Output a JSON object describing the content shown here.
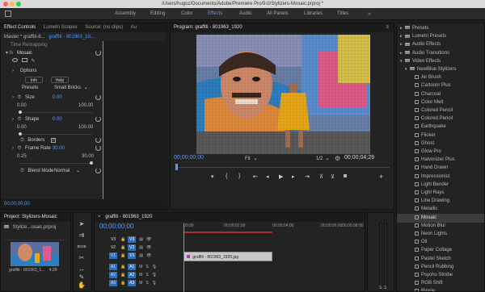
{
  "title_bar": {
    "text": "/Users/hugoz/Documents/Adobe/Premiere Pro/9.0/Stylizers-Mosaic.prproj *"
  },
  "workspaces": [
    "Assembly",
    "Editing",
    "Color",
    "Effects",
    "Audio",
    "All Panels",
    "Libraries",
    "Titles"
  ],
  "active_workspace": "Effects",
  "effect_controls": {
    "tabs": [
      "Effect Controls",
      "Lumetri Scopes",
      "Source: (no clips)",
      "Au"
    ],
    "master": "Master * graffiti-8...",
    "clip": "graffiti - 801963_19...",
    "time_remapping": "Time Remapping",
    "effect_name": "Mosaic",
    "options_label": "Options",
    "preset_buttons": [
      "Info",
      "Help"
    ],
    "presets_label": "Presets",
    "presets_value": "Small Bricks",
    "size": {
      "label": "Size",
      "value": "0.00",
      "min": "0.00",
      "max": "100.00",
      "level": 0.0
    },
    "shape": {
      "label": "Shape",
      "value": "0.00",
      "min": "0.00",
      "max": "100.00",
      "level": 0.0
    },
    "borders": {
      "label": "Borders",
      "checked": true
    },
    "frame_rate": {
      "label": "Frame Rate",
      "value": "30.00",
      "min": "0.25",
      "max": "30.00",
      "level": 1.0
    },
    "blend_mode": {
      "label": "Blend Mode",
      "value": "Normal"
    }
  },
  "program": {
    "tab": "Program: graffiti - 801963_1920",
    "timecode_in": "00;00;00;00",
    "fit": "Fit",
    "ratio": "1/2",
    "timecode_duration": "00;00;04;29"
  },
  "project": {
    "tab": "Project: Stylizers-Mosaic",
    "file": "Stylize...osaic.prproj",
    "clip_name": "graffiti - 801963_1...",
    "clip_duration": "4;29"
  },
  "timeline": {
    "tab": "graffiti - 801963_1920",
    "timecode": "00;00;00;00",
    "ruler": [
      "00;00",
      "00;00;02;00",
      "00;00;04;00",
      "00;00;06;00",
      "00;00;08;00"
    ],
    "video_tracks": [
      "V3",
      "V2",
      "V1"
    ],
    "audio_tracks": [
      "A1",
      "A2",
      "A3"
    ],
    "clip_label": "graffiti - 801963_1920.jpg"
  },
  "effects": {
    "items": [
      {
        "label": "Presets",
        "type": "folder",
        "indent": 0
      },
      {
        "label": "Lumetri Presets",
        "type": "folder",
        "indent": 0
      },
      {
        "label": "Audio Effects",
        "type": "folder",
        "indent": 0
      },
      {
        "label": "Audio Transitions",
        "type": "folder",
        "indent": 0
      },
      {
        "label": "Video Effects",
        "type": "folder",
        "indent": 0
      },
      {
        "label": "NewBlue Stylizers",
        "type": "folder",
        "indent": 1
      },
      {
        "label": "Air Brush",
        "type": "fx",
        "indent": 2
      },
      {
        "label": "Cartoonr Plus",
        "type": "fx",
        "indent": 2
      },
      {
        "label": "Charcoal",
        "type": "fx",
        "indent": 2
      },
      {
        "label": "Color Melt",
        "type": "fx",
        "indent": 2
      },
      {
        "label": "Colored Pencil",
        "type": "fx",
        "indent": 2
      },
      {
        "label": "Colored Pencil",
        "type": "fx",
        "indent": 2
      },
      {
        "label": "Earthquake",
        "type": "fx",
        "indent": 2
      },
      {
        "label": "Flicker",
        "type": "fx",
        "indent": 2
      },
      {
        "label": "Ghost",
        "type": "fx",
        "indent": 2
      },
      {
        "label": "Glow Pro",
        "type": "fx",
        "indent": 2
      },
      {
        "label": "Halvonizer Plus",
        "type": "fx",
        "indent": 2
      },
      {
        "label": "Hand Drawn",
        "type": "fx",
        "indent": 2
      },
      {
        "label": "Impressionist",
        "type": "fx",
        "indent": 2
      },
      {
        "label": "Light Bender",
        "type": "fx",
        "indent": 2
      },
      {
        "label": "Light Rays",
        "type": "fx",
        "indent": 2
      },
      {
        "label": "Line Drawing",
        "type": "fx",
        "indent": 2
      },
      {
        "label": "Metallic",
        "type": "fx",
        "indent": 2
      },
      {
        "label": "Mosaic",
        "type": "fx",
        "indent": 2,
        "selected": true
      },
      {
        "label": "Motion Blur",
        "type": "fx",
        "indent": 2
      },
      {
        "label": "Neon Lights",
        "type": "fx",
        "indent": 2
      },
      {
        "label": "Oil",
        "type": "fx",
        "indent": 2
      },
      {
        "label": "Paper Collage",
        "type": "fx",
        "indent": 2
      },
      {
        "label": "Pastel Sketch",
        "type": "fx",
        "indent": 2
      },
      {
        "label": "Pencil Rubbing",
        "type": "fx",
        "indent": 2
      },
      {
        "label": "Psycho Strobe",
        "type": "fx",
        "indent": 2
      },
      {
        "label": "RGB Shift",
        "type": "fx",
        "indent": 2
      },
      {
        "label": "Ripple",
        "type": "fx",
        "indent": 2
      },
      {
        "label": "Rolling Waves",
        "type": "fx",
        "indent": 2
      }
    ]
  },
  "colors": {
    "accent": "#4e9cff",
    "playhead": "#4e9cff",
    "work_area": "#b03030"
  }
}
